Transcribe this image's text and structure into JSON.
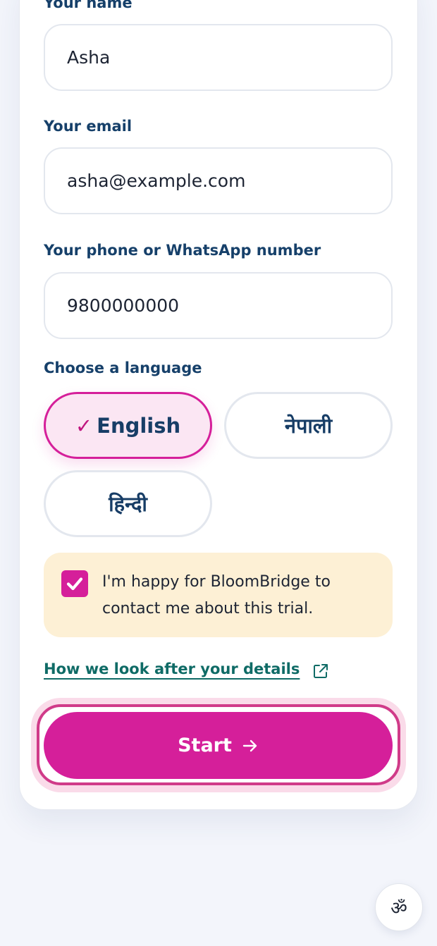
{
  "form": {
    "name": {
      "label": "Your name",
      "value": "Asha"
    },
    "email": {
      "label": "Your email",
      "value": "asha@example.com"
    },
    "phone": {
      "label": "Your phone or WhatsApp number",
      "value": "9800000000"
    },
    "language": {
      "label": "Choose a language",
      "options": [
        {
          "label": "English",
          "selected": true,
          "check": "✓"
        },
        {
          "label": "नेपाली",
          "selected": false
        },
        {
          "label": "हिन्दी",
          "selected": false
        }
      ]
    },
    "consent": {
      "checked": true,
      "text": "I'm happy for BloomBridge to contact me about this trial."
    },
    "privacy_link": "How we look after your details",
    "start_button": "Start"
  },
  "language_fab": {
    "glyph": "ॐ",
    "icon": "language-switch-icon"
  },
  "colors": {
    "accent": "#d51f9a",
    "heading": "#16406a",
    "link": "#0f6b66",
    "consent_bg": "#fdf0d5",
    "selected_bg": "#fbe6f3"
  }
}
